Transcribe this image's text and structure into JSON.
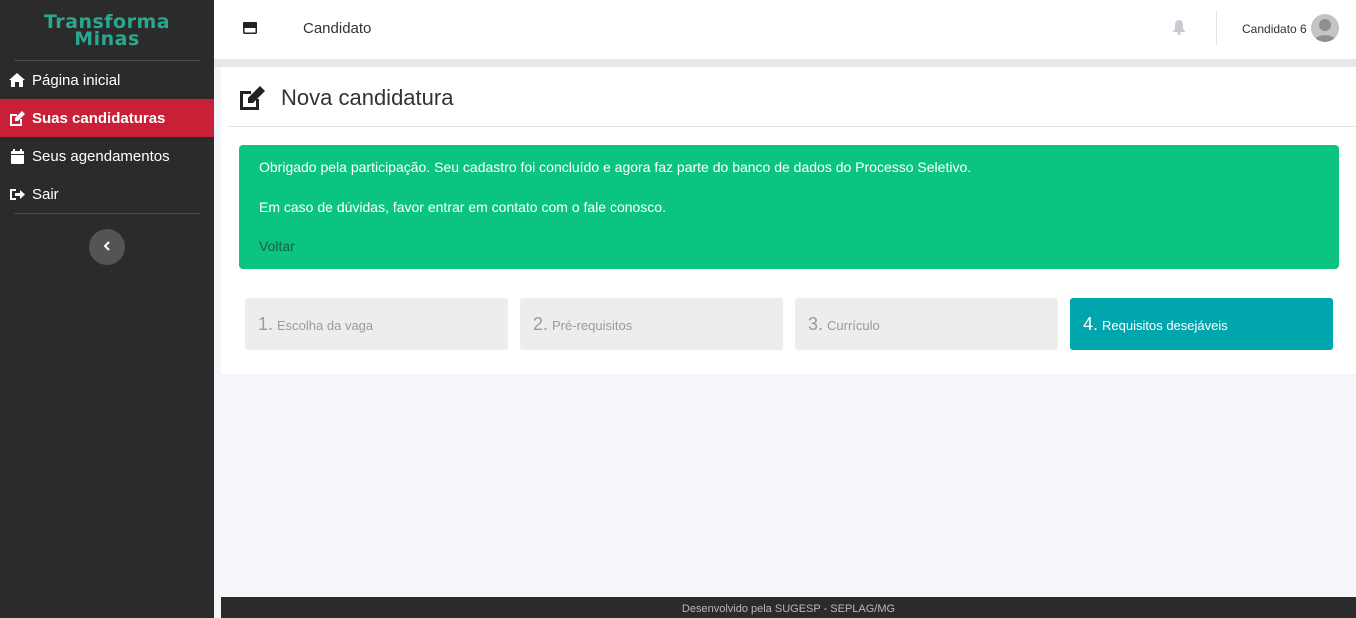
{
  "logo": {
    "line1": "Transforma",
    "line2": "Minas"
  },
  "sidebar": {
    "items": [
      {
        "label": "Página inicial",
        "icon": "home-icon"
      },
      {
        "label": "Suas candidaturas",
        "icon": "edit-icon",
        "active": true
      },
      {
        "label": "Seus agendamentos",
        "icon": "calendar-icon"
      },
      {
        "label": "Sair",
        "icon": "sign-out-icon"
      }
    ],
    "collapse_icon": "chevron-left-icon"
  },
  "header": {
    "title": "Candidato",
    "user_name": "Candidato 6",
    "menu_icon": "window-icon",
    "bell_icon": "bell-icon"
  },
  "page": {
    "title": "Nova candidatura",
    "title_icon": "edit-icon"
  },
  "alert": {
    "message1": "Obrigado pela participação. Seu cadastro foi concluído e agora faz parte do banco de dados do Processo Seletivo.",
    "message2": "Em caso de dúvidas, favor entrar em contato com o fale conosco.",
    "back_link": "Voltar",
    "color": "#0cc482"
  },
  "steps": [
    {
      "number": "1.",
      "label": "Escolha da vaga"
    },
    {
      "number": "2.",
      "label": "Pré-requisitos"
    },
    {
      "number": "3.",
      "label": "Currículo"
    },
    {
      "number": "4.",
      "label": "Requisitos desejáveis",
      "active": true
    }
  ],
  "footer": {
    "text": "Desenvolvido pela SUGESP - SEPLAG/MG"
  },
  "colors": {
    "sidebar_bg": "#2b2b2c",
    "active_nav": "#c91f37",
    "active_step": "#00a6ad",
    "logo": "#2aa88f"
  }
}
